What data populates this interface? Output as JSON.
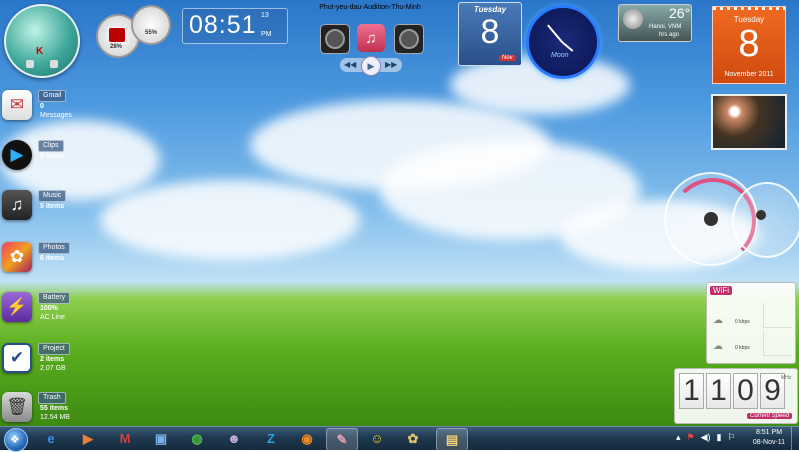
{
  "sidebar": {
    "items": [
      {
        "label": "Gmail",
        "line1": "0",
        "line2": "Messages",
        "icon": "mail-icon"
      },
      {
        "label": "Clips",
        "line1": "5 items",
        "line2": "",
        "icon": "media-play-icon"
      },
      {
        "label": "Music",
        "line1": "5 items",
        "line2": "",
        "icon": "music-icon"
      },
      {
        "label": "Photos",
        "line1": "6 items",
        "line2": "",
        "icon": "photos-icon"
      },
      {
        "label": "Battery",
        "line1": "100%",
        "line2": "AC Line",
        "icon": "lightning-icon"
      },
      {
        "label": "Project",
        "line1": "2 items",
        "line2": "2.07 GB",
        "icon": "checkbox-icon"
      },
      {
        "label": "Trash",
        "line1": "55 items",
        "line2": "12.54 MB",
        "icon": "trash-icon"
      }
    ]
  },
  "gauges": {
    "cpu_label": "28%",
    "mem_label": "55%"
  },
  "clock": {
    "time": "08:51",
    "seconds": "13",
    "ampm": "PM"
  },
  "media": {
    "track": "Phut-yeu-dau-Audition-Thu-Minh"
  },
  "calendar_small": {
    "day_name": "Tuesday",
    "day": "8",
    "month": "Nov"
  },
  "analog_clock": {
    "label": "Moon"
  },
  "weather": {
    "temp": "26°",
    "location": "Hanoi, VNM",
    "updated": "hrs ago"
  },
  "calendar_large": {
    "day_name": "Tuesday",
    "day": "8",
    "month_year": "November 2011"
  },
  "network": {
    "title": "WiFi",
    "down_speed": "0 kbps",
    "up_speed": "0 kbps"
  },
  "flip_counter": {
    "digits": [
      "1",
      "1",
      "0",
      "9"
    ],
    "unit": "MHz",
    "label": "Current Speed"
  },
  "taskbar": {
    "items": [
      {
        "name": "ie-icon",
        "glyph": "e",
        "color": "#3a8ee8"
      },
      {
        "name": "media-player-icon",
        "glyph": "▶",
        "color": "#e8803a"
      },
      {
        "name": "mifi-icon",
        "glyph": "M",
        "color": "#d04040"
      },
      {
        "name": "computer-icon",
        "glyph": "▣",
        "color": "#7ab0e8"
      },
      {
        "name": "globe-icon",
        "glyph": "◍",
        "color": "#4ab84a"
      },
      {
        "name": "character-icon",
        "glyph": "☻",
        "color": "#c8b0e0"
      },
      {
        "name": "z-app-icon",
        "glyph": "Z",
        "color": "#2aa0e0"
      },
      {
        "name": "firefox-icon",
        "glyph": "◉",
        "color": "#f08a20"
      },
      {
        "name": "paint-icon",
        "glyph": "✎",
        "color": "#e0a0b0"
      },
      {
        "name": "yahoo-messenger-icon",
        "glyph": "☺",
        "color": "#f0d020"
      },
      {
        "name": "palette-icon",
        "glyph": "✿",
        "color": "#e0c070"
      },
      {
        "name": "folder-icon",
        "glyph": "▤",
        "color": "#f0d070"
      }
    ],
    "time": "8:51 PM",
    "date": "08-Nov-11"
  }
}
